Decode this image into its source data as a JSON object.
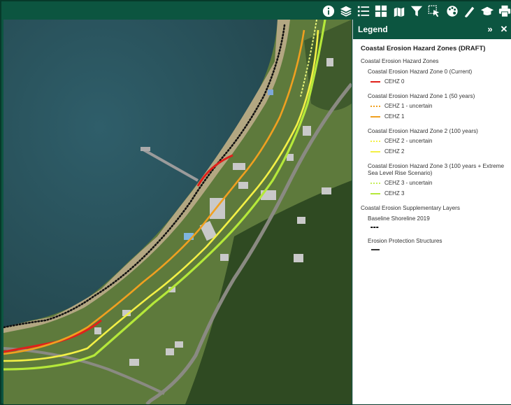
{
  "toolbar": {
    "tools": [
      {
        "icon": "info-icon"
      },
      {
        "icon": "layers-icon"
      },
      {
        "icon": "legend-list-icon"
      },
      {
        "icon": "basemap-grid-icon"
      },
      {
        "icon": "print-map-icon"
      },
      {
        "icon": "filter-icon"
      },
      {
        "icon": "select-icon"
      },
      {
        "icon": "palette-icon"
      },
      {
        "icon": "measure-icon"
      },
      {
        "icon": "education-icon"
      },
      {
        "icon": "printer-icon"
      }
    ]
  },
  "legend": {
    "header": "Legend",
    "collapse_glyph": "»",
    "close_glyph": "✕",
    "title": "Coastal Erosion Hazard Zones (DRAFT)",
    "layer_hazard": "Coastal Erosion Hazard Zones",
    "zone0": "Coastal Erosion Hazard Zone 0 (Current)",
    "cehz0": "CEHZ 0",
    "zone1": "Coastal Erosion Hazard Zone 1 (50 years)",
    "cehz1u": "CEHZ 1 - uncertain",
    "cehz1": "CEHZ 1",
    "zone2": "Coastal Erosion Hazard Zone 2 (100 years)",
    "cehz2u": "CEHZ 2 - uncertain",
    "cehz2": "CEHZ 2",
    "zone3": "Coastal Erosion Hazard Zone 3 (100 years + Extreme Sea Level Rise Scenario)",
    "cehz3u": "CEHZ 3 - uncertain",
    "cehz3": "CEHZ 3",
    "layer_supp": "Coastal Erosion Supplementary Layers",
    "baseline": "Baseline Shoreline 2019",
    "protection": "Erosion Protection Structures"
  },
  "colors": {
    "toolbar_bg": "#0c5540",
    "cehz0": "#e0201b",
    "cehz1": "#f0a020",
    "cehz2": "#f3f046",
    "cehz3": "#b5e83a",
    "shoreline": "#111111",
    "protection": "#333333"
  }
}
